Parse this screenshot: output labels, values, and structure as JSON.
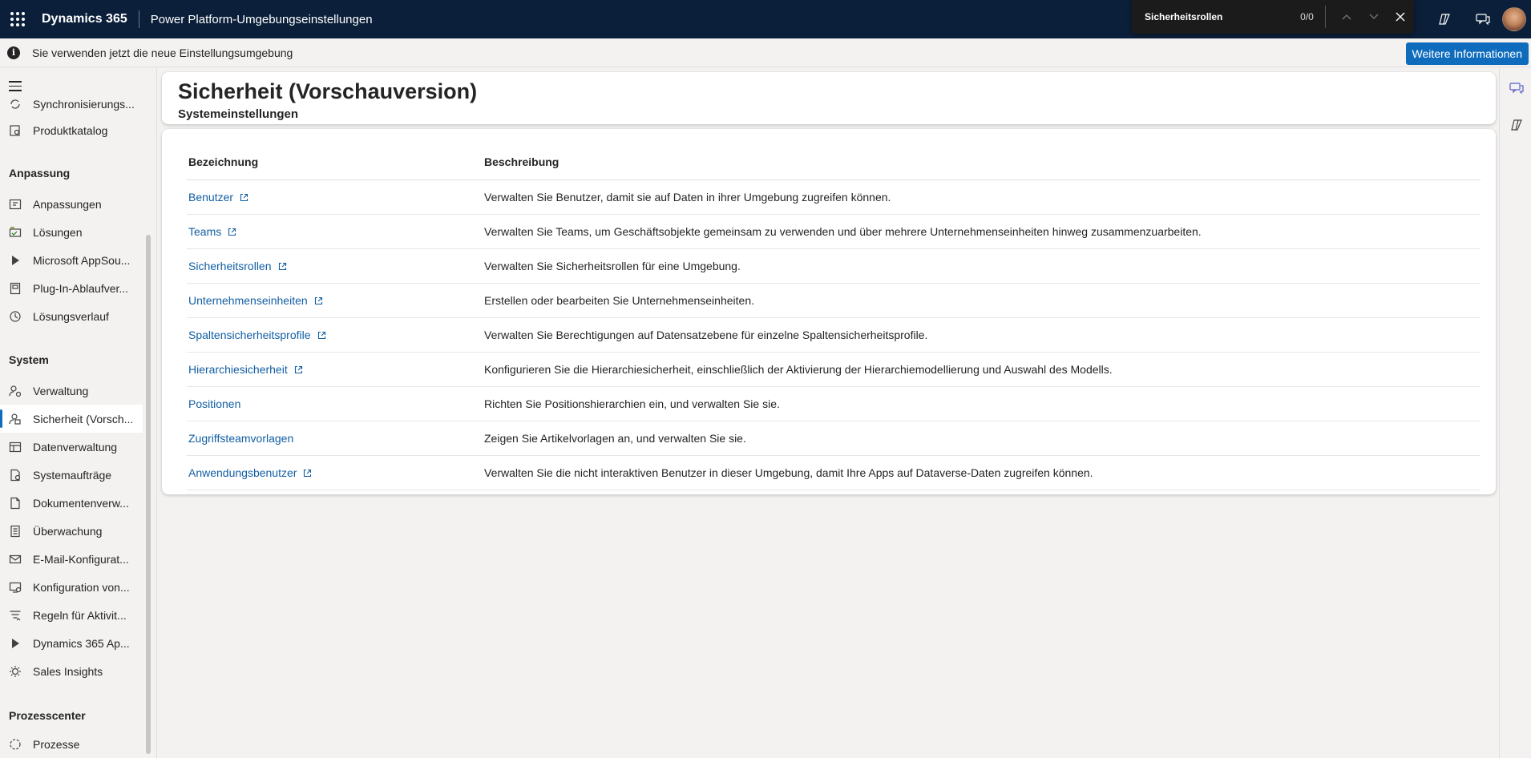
{
  "topbar": {
    "app_name": "Dynamics 365",
    "environment_title": "Power Platform-Umgebungseinstellungen",
    "icons": [
      "waffle-icon",
      "copilot-icon",
      "chat-icon",
      "avatar"
    ]
  },
  "find": {
    "query": "Sicherheitsrollen",
    "count": "0/0"
  },
  "infobar": {
    "text": "Sie verwenden jetzt die neue Einstellungsumgebung",
    "button_label": "Weitere Informationen"
  },
  "sidebar": {
    "items_top": [
      {
        "label": "Synchronisierungs...",
        "icon": "sync-icon"
      },
      {
        "label": "Produktkatalog",
        "icon": "catalog-icon"
      }
    ],
    "group_anpassung": "Anpassung",
    "items_anpassung": [
      {
        "label": "Anpassungen",
        "icon": "customize-icon"
      },
      {
        "label": "Lösungen",
        "icon": "solutions-icon"
      },
      {
        "label": "Microsoft AppSou...",
        "icon": "appsource-icon"
      },
      {
        "label": "Plug-In-Ablaufver...",
        "icon": "plugin-icon"
      },
      {
        "label": "Lösungsverlauf",
        "icon": "history-icon"
      }
    ],
    "group_system": "System",
    "items_system": [
      {
        "label": "Verwaltung",
        "icon": "admin-icon"
      },
      {
        "label": "Sicherheit (Vorsch...",
        "icon": "security-icon"
      },
      {
        "label": "Datenverwaltung",
        "icon": "data-icon"
      },
      {
        "label": "Systemaufträge",
        "icon": "jobs-icon"
      },
      {
        "label": "Dokumentenverw...",
        "icon": "document-icon"
      },
      {
        "label": "Überwachung",
        "icon": "audit-icon"
      },
      {
        "label": "E-Mail-Konfigurat...",
        "icon": "mail-icon"
      },
      {
        "label": "Konfiguration von...",
        "icon": "config-icon"
      },
      {
        "label": "Regeln für Aktivit...",
        "icon": "rules-icon"
      },
      {
        "label": "Dynamics 365 Ap...",
        "icon": "dynamics-icon"
      },
      {
        "label": "Sales Insights",
        "icon": "insights-icon"
      }
    ],
    "group_prozess": "Prozesscenter",
    "items_prozess": [
      {
        "label": "Prozesse",
        "icon": "process-icon"
      }
    ]
  },
  "page": {
    "title": "Sicherheit (Vorschauversion)",
    "subtitle": "Systemeinstellungen"
  },
  "table": {
    "col_name": "Bezeichnung",
    "col_desc": "Beschreibung",
    "rows": [
      {
        "name": "Benutzer",
        "external": true,
        "desc": "Verwalten Sie Benutzer, damit sie auf Daten in ihrer Umgebung zugreifen können."
      },
      {
        "name": "Teams",
        "external": true,
        "desc": "Verwalten Sie Teams, um Geschäftsobjekte gemeinsam zu verwenden und über mehrere Unternehmenseinheiten hinweg zusammenzuarbeiten."
      },
      {
        "name": "Sicherheitsrollen",
        "external": true,
        "desc": "Verwalten Sie Sicherheitsrollen für eine Umgebung."
      },
      {
        "name": "Unternehmenseinheiten",
        "external": true,
        "desc": "Erstellen oder bearbeiten Sie Unternehmenseinheiten."
      },
      {
        "name": "Spaltensicherheitsprofile",
        "external": true,
        "desc": "Verwalten Sie Berechtigungen auf Datensatzebene für einzelne Spaltensicherheitsprofile."
      },
      {
        "name": "Hierarchiesicherheit",
        "external": true,
        "desc": "Konfigurieren Sie die Hierarchiesicherheit, einschließlich der Aktivierung der Hierarchiemodellierung und Auswahl des Modells."
      },
      {
        "name": "Positionen",
        "external": false,
        "desc": "Richten Sie Positionshierarchien ein, und verwalten Sie sie."
      },
      {
        "name": "Zugriffsteamvorlagen",
        "external": false,
        "desc": "Zeigen Sie Artikelvorlagen an, und verwalten Sie sie."
      },
      {
        "name": "Anwendungsbenutzer",
        "external": true,
        "desc": "Verwalten Sie die nicht interaktiven Benutzer in dieser Umgebung, damit Ihre Apps auf Dataverse-Daten zugreifen können."
      }
    ]
  }
}
